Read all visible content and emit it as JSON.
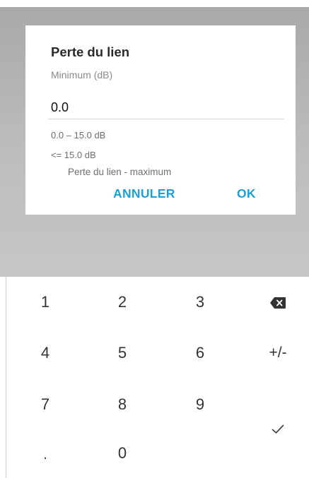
{
  "dialog": {
    "title": "Perte du lien",
    "field_label": "Minimum (dB)",
    "value": "0.0",
    "range": "0.0 – 15.0 dB",
    "limit": "<= 15.0 dB",
    "related": "Perte du lien - maximum",
    "cancel_label": "ANNULER",
    "ok_label": "OK",
    "accent_color": "#1aa0d8"
  },
  "keypad": {
    "keys": [
      "1",
      "2",
      "3",
      "4",
      "5",
      "6",
      "+/-",
      "7",
      "8",
      "9",
      ".",
      "0"
    ],
    "backspace_icon": "backspace-icon",
    "done_icon": "checkmark-icon"
  }
}
